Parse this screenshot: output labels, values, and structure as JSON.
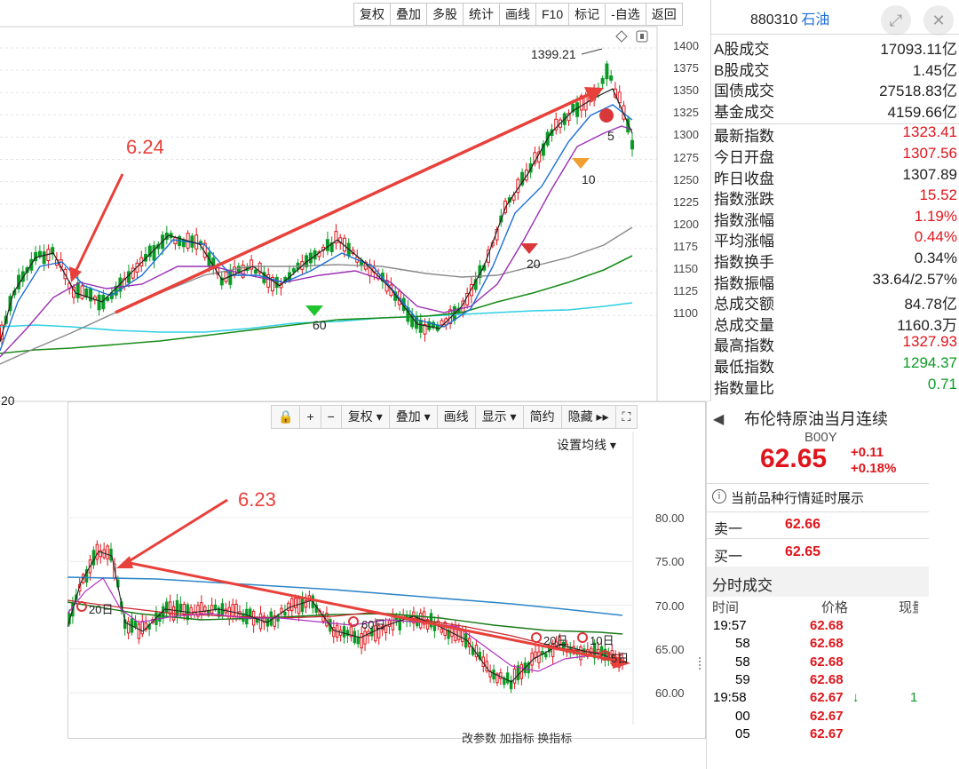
{
  "top_toolbar": [
    "复权",
    "叠加",
    "多股",
    "统计",
    "画线",
    "F10",
    "标记",
    "-自选",
    "返回"
  ],
  "top_chart": {
    "y_ticks": [
      "1400",
      "1375",
      "1350",
      "1325",
      "1300",
      "1275",
      "1250",
      "1225",
      "1200",
      "1175",
      "1150",
      "1125",
      "1100"
    ],
    "high_label": "1399.21",
    "annotation": "6.24",
    "left_label": "20",
    "ma_markers": [
      "60",
      "20",
      "10",
      "5"
    ]
  },
  "quote_top": {
    "code": "880310",
    "name": "石油",
    "rows": [
      {
        "label": "A股成交",
        "value": "17093.11亿",
        "color": "black"
      },
      {
        "label": "B股成交",
        "value": "1.45亿",
        "color": "black"
      },
      {
        "label": "国债成交",
        "value": "27518.83亿",
        "color": "black"
      },
      {
        "label": "基金成交",
        "value": "4159.66亿",
        "color": "black"
      },
      {
        "label": "最新指数",
        "value": "1323.41",
        "color": "red"
      },
      {
        "label": "今日开盘",
        "value": "1307.56",
        "color": "red"
      },
      {
        "label": "昨日收盘",
        "value": "1307.89",
        "color": "black"
      },
      {
        "label": "指数涨跌",
        "value": "15.52",
        "color": "red"
      },
      {
        "label": "指数涨幅",
        "value": "1.19%",
        "color": "red"
      },
      {
        "label": "平均涨幅",
        "value": "0.44%",
        "color": "red"
      },
      {
        "label": "指数换手",
        "value": "0.34%",
        "color": "black"
      },
      {
        "label": "指数振幅",
        "value": "33.64/2.57%",
        "color": "black"
      },
      {
        "label": "总成交额",
        "value": "84.78亿",
        "color": "black"
      },
      {
        "label": "总成交量",
        "value": "1160.3万",
        "color": "black"
      },
      {
        "label": "最高指数",
        "value": "1327.93",
        "color": "red"
      },
      {
        "label": "最低指数",
        "value": "1294.37",
        "color": "green"
      },
      {
        "label": "指数量比",
        "value": "0.71",
        "color": "green"
      }
    ]
  },
  "bottom_toolbar": [
    "复权 ▾",
    "叠加 ▾",
    "画线",
    "显示 ▾",
    "简约",
    "隐藏 ▸▸"
  ],
  "bottom_chart": {
    "settings": "设置均线 ▾",
    "annotation": "6.23",
    "y_ticks": [
      "80.00",
      "75.00",
      "70.00",
      "65.00",
      "60.00"
    ],
    "ma_markers": [
      "20日",
      "60日",
      "20日",
      "10日",
      "5日"
    ],
    "footer": "改参数  加指标  换指标"
  },
  "quote_bottom": {
    "title": "布伦特原油当月连续",
    "code": "B00Y",
    "price": "62.65",
    "change": "+0.11",
    "change_pct": "+0.18%",
    "notice": "当前品种行情延时展示",
    "sell_label": "卖一",
    "sell_price": "62.66",
    "buy_label": "买一",
    "buy_price": "62.65",
    "ticks_title": "分时成交",
    "col_time": "时间",
    "col_price": "价格",
    "col_vol": "现量",
    "ticks": [
      {
        "time": "19:57",
        "price": "62.68",
        "arrow": "",
        "vol": ""
      },
      {
        "time": "58",
        "price": "62.68",
        "arrow": "",
        "vol": ""
      },
      {
        "time": "58",
        "price": "62.68",
        "arrow": "",
        "vol": ""
      },
      {
        "time": "59",
        "price": "62.68",
        "arrow": "",
        "vol": ""
      },
      {
        "time": "19:58",
        "price": "62.67",
        "arrow": "↓",
        "vol": "1"
      },
      {
        "time": "00",
        "price": "62.67",
        "arrow": "",
        "vol": ""
      },
      {
        "time": "05",
        "price": "62.67",
        "arrow": "",
        "vol": ""
      }
    ]
  },
  "colors": {
    "up": "#e0151b",
    "down": "#0a9b25",
    "annotation": "#e8403a",
    "ma_blue": "#1b6fd8",
    "ma_cyan": "#2ecfe3",
    "ma_purple": "#9a2fb3",
    "ma_green": "#1a8c1a",
    "ma_grey": "#7a7a7a"
  }
}
